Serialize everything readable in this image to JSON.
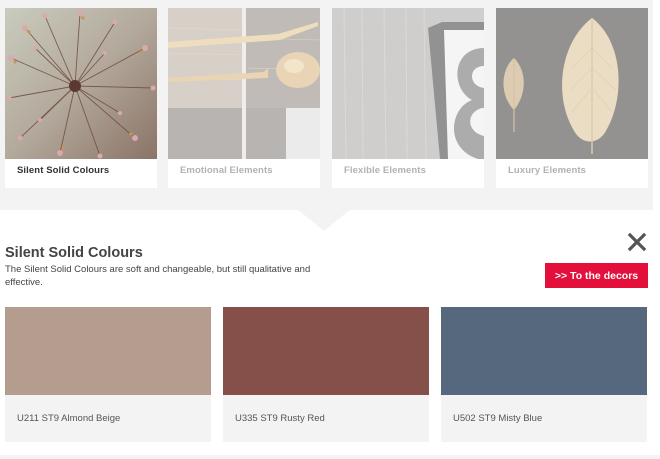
{
  "categories": [
    {
      "label": "Silent Solid Colours",
      "active": true
    },
    {
      "label": "Emotional Elements",
      "active": false
    },
    {
      "label": "Flexible Elements",
      "active": false
    },
    {
      "label": "Luxury Elements",
      "active": false
    }
  ],
  "detail": {
    "title": "Silent Solid Colours",
    "description": "The Silent Solid Colours are soft and changeable, but still qualitative and effective.",
    "cta_label": ">> To the decors",
    "close_icon": "close-icon",
    "accent_color": "#e4103c"
  },
  "decors": [
    {
      "label": "U211 ST9 Almond Beige",
      "color": "#b49d8e"
    },
    {
      "label": "U335 ST9 Rusty Red",
      "color": "#86504a"
    },
    {
      "label": "U502 ST9 Misty Blue",
      "color": "#56687e"
    }
  ]
}
